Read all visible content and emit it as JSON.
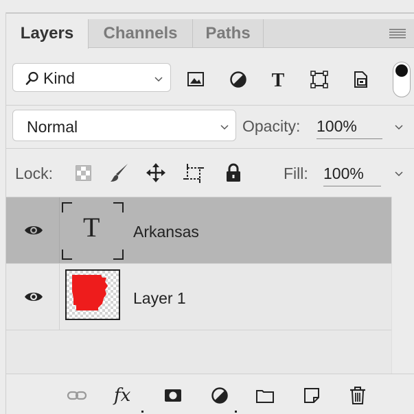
{
  "tabs": [
    {
      "label": "Layers",
      "active": true
    },
    {
      "label": "Channels",
      "active": false
    },
    {
      "label": "Paths",
      "active": false
    }
  ],
  "filter": {
    "kind_label": "Kind",
    "icons": [
      "image-filter-icon",
      "adjustment-filter-icon",
      "type-filter-icon",
      "shape-filter-icon",
      "smart-object-filter-icon"
    ],
    "toggle_on": true
  },
  "blend": {
    "mode": "Normal",
    "opacity_label": "Opacity:",
    "opacity_value": "100%"
  },
  "lock": {
    "label": "Lock:",
    "icons": [
      "lock-transparent-pixels-icon",
      "lock-image-pixels-icon",
      "lock-position-icon",
      "lock-artboard-icon",
      "lock-all-icon"
    ],
    "fill_label": "Fill:",
    "fill_value": "100%"
  },
  "layers": [
    {
      "name": "Arkansas",
      "type": "text",
      "thumb_glyph": "T",
      "visible": true,
      "selected": true
    },
    {
      "name": "Layer 1",
      "type": "raster",
      "visible": true,
      "selected": false
    }
  ],
  "bottom_toolbar": [
    "link-layers-icon",
    "fx-icon",
    "add-mask-icon",
    "new-adjustment-icon",
    "new-group-icon",
    "new-layer-icon",
    "delete-layer-icon"
  ],
  "bottom_fx_label": "fx",
  "colors": {
    "panel_bg": "#ececec",
    "selected_row": "#b6b6b6",
    "layer_fill_red": "#ee1c1c"
  }
}
